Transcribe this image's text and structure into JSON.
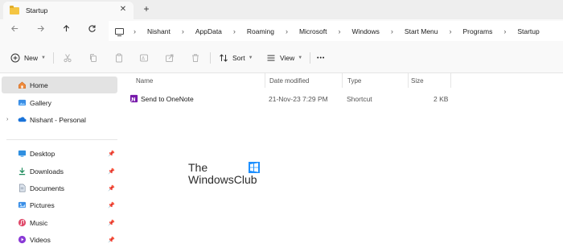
{
  "window": {
    "tab_title": "Startup",
    "close_glyph": "✕",
    "new_tab_glyph": "+"
  },
  "nav": {
    "back_icon": "arrow-left-icon",
    "forward_icon": "arrow-right-icon",
    "up_icon": "arrow-up-icon",
    "refresh_icon": "refresh-icon"
  },
  "breadcrumb": [
    "Nishant",
    "AppData",
    "Roaming",
    "Microsoft",
    "Windows",
    "Start Menu",
    "Programs",
    "Startup"
  ],
  "toolbar": {
    "new_label": "New",
    "sort_label": "Sort",
    "view_label": "View",
    "more_glyph": "•••"
  },
  "sidebar": {
    "items": [
      {
        "label": "Home",
        "icon": "home-icon",
        "selected": true
      },
      {
        "label": "Gallery",
        "icon": "gallery-icon"
      },
      {
        "label": "Nishant - Personal",
        "icon": "onedrive-icon"
      },
      {
        "label": "Desktop",
        "icon": "desktop-icon"
      },
      {
        "label": "Downloads",
        "icon": "downloads-icon"
      },
      {
        "label": "Documents",
        "icon": "documents-icon"
      },
      {
        "label": "Pictures",
        "icon": "pictures-icon"
      },
      {
        "label": "Music",
        "icon": "music-icon"
      },
      {
        "label": "Videos",
        "icon": "videos-icon"
      }
    ],
    "pin_glyph": "📌",
    "expand_glyph": "›"
  },
  "columns": [
    "Name",
    "Date modified",
    "Type",
    "Size"
  ],
  "files": [
    {
      "name": "Send to OneNote",
      "date_modified": "21-Nov-23 7:29 PM",
      "type": "Shortcut",
      "size": "2 KB"
    }
  ],
  "watermark": {
    "line1": "The",
    "line2": "WindowsClub"
  },
  "colors": {
    "accent": "#0067c0",
    "onenote": "#7719aa",
    "folder": "#f4c542"
  }
}
